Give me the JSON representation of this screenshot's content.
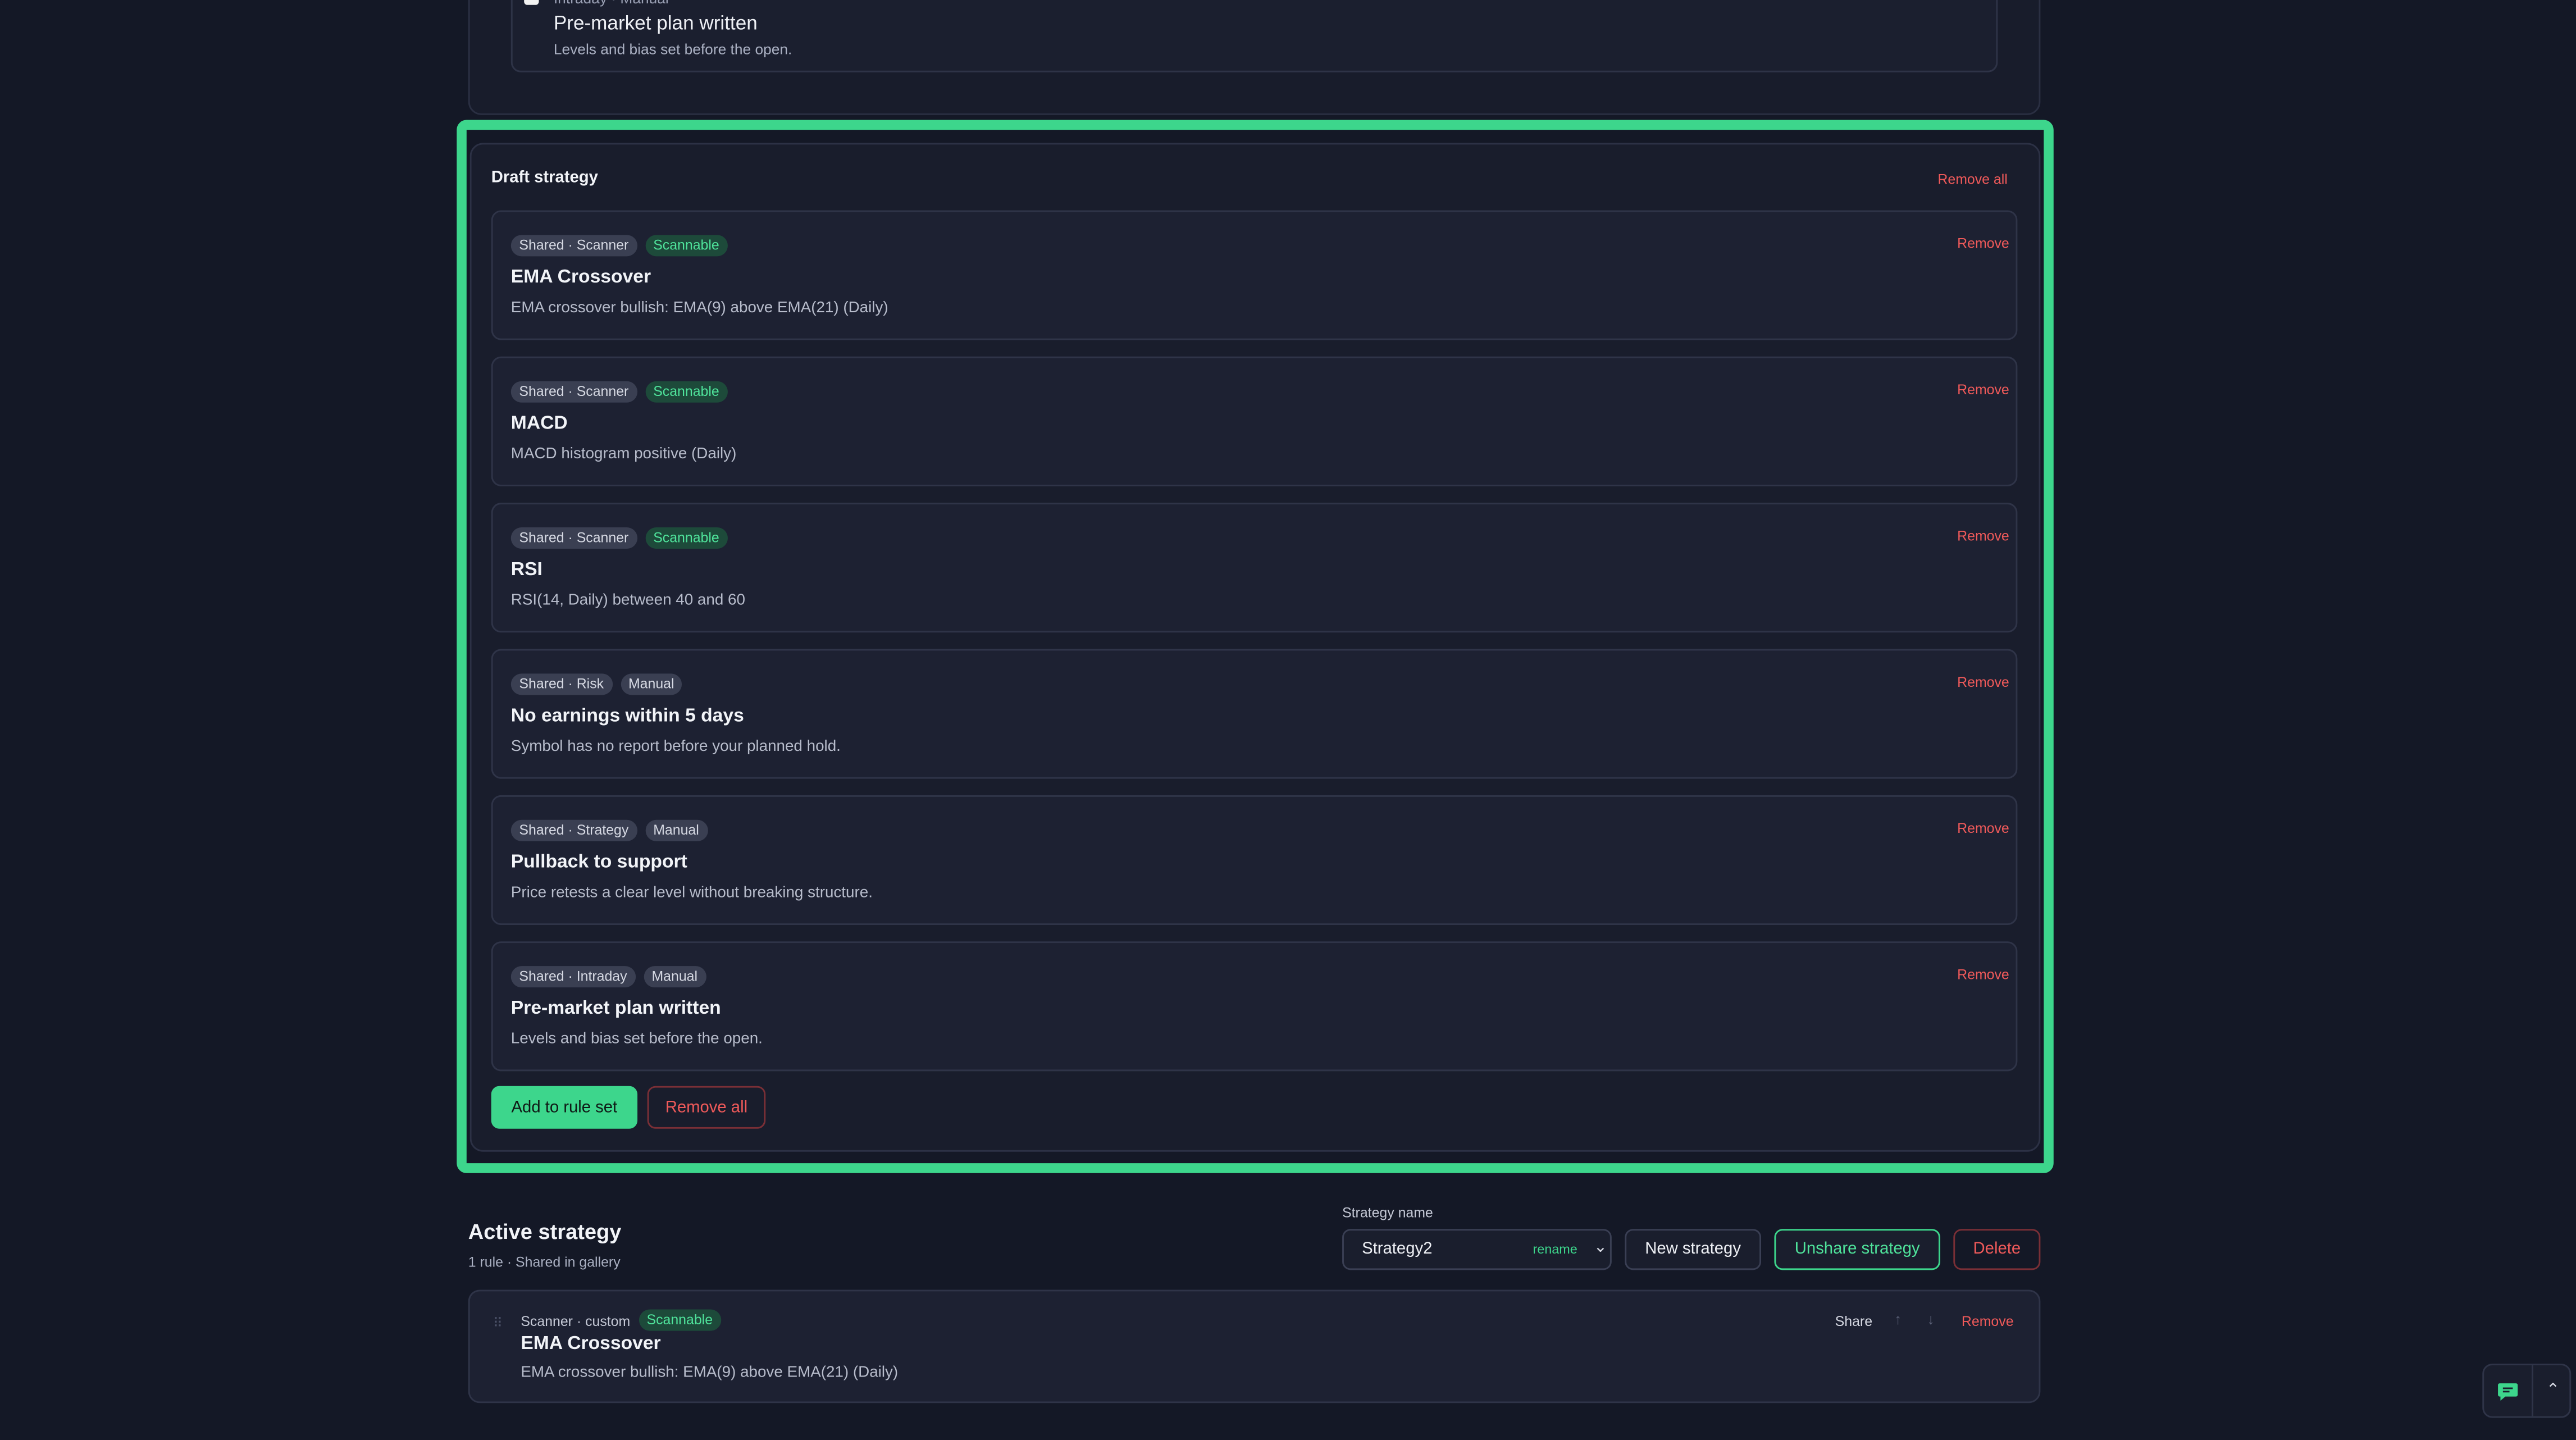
{
  "previous": {
    "meta": "Intraday · Manual",
    "title": "Pre-market plan written",
    "desc": "Levels and bias set before the open."
  },
  "draft": {
    "title": "Draft strategy",
    "remove_all_link": "Remove all",
    "rules": [
      {
        "tag": "Shared · Scanner",
        "status": "Scannable",
        "title": "EMA Crossover",
        "desc": "EMA crossover bullish: EMA(9) above EMA(21) (Daily)",
        "remove": "Remove"
      },
      {
        "tag": "Shared · Scanner",
        "status": "Scannable",
        "title": "MACD",
        "desc": "MACD histogram positive (Daily)",
        "remove": "Remove"
      },
      {
        "tag": "Shared · Scanner",
        "status": "Scannable",
        "title": "RSI",
        "desc": "RSI(14, Daily) between 40 and 60",
        "remove": "Remove"
      },
      {
        "tag": "Shared · Risk",
        "status": "Manual",
        "title": "No earnings within 5 days",
        "desc": "Symbol has no report before your planned hold.",
        "remove": "Remove"
      },
      {
        "tag": "Shared · Strategy",
        "status": "Manual",
        "title": "Pullback to support",
        "desc": "Price retests a clear level without breaking structure.",
        "remove": "Remove"
      },
      {
        "tag": "Shared · Intraday",
        "status": "Manual",
        "title": "Pre-market plan written",
        "desc": "Levels and bias set before the open.",
        "remove": "Remove"
      }
    ],
    "add_button": "Add to rule set",
    "remove_all_button": "Remove all"
  },
  "active": {
    "title": "Active strategy",
    "subtitle": "1 rule · Shared in gallery",
    "strategy_name_label": "Strategy name",
    "strategy_name_value": "Strategy2",
    "rename": "rename",
    "new_button": "New strategy",
    "unshare_button": "Unshare strategy",
    "delete_button": "Delete",
    "card": {
      "meta": "Scanner · custom",
      "status": "Scannable",
      "title": "EMA Crossover",
      "desc": "EMA crossover bullish: EMA(9) above EMA(21) (Daily)",
      "share": "Share",
      "up": "↑",
      "down": "↓",
      "remove": "Remove"
    }
  },
  "colors": {
    "accent": "#3dd68c",
    "danger": "#f05a5a",
    "background": "#141826"
  },
  "icons": {
    "chat": "chat-bubble-icon",
    "collapse": "chevron-up-icon",
    "drag": "drag-handle-icon"
  }
}
